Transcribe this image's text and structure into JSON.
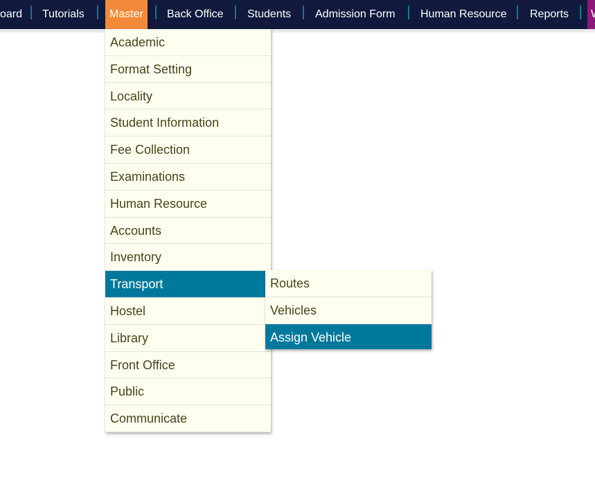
{
  "nav": {
    "items": [
      "oard",
      "Tutorials",
      "Master",
      "Back Office",
      "Students",
      "Admission Form",
      "Human Resource",
      "Reports"
    ],
    "overflow": "W",
    "active": "Master"
  },
  "colors": {
    "nav_bg": "#111a3d",
    "active": "#f28a3a",
    "highlight": "#00789c",
    "menu_bg": "#fffff0"
  },
  "master_menu": [
    "Academic",
    "Format Setting",
    "Locality",
    "Student Information",
    "Fee Collection",
    "Examinations",
    "Human Resource",
    "Accounts",
    "Inventory",
    "Transport",
    "Hostel",
    "Library",
    "Front Office",
    "Public",
    "Communicate"
  ],
  "transport_submenu": [
    "Routes",
    "Vehicles",
    "Assign Vehicle"
  ]
}
